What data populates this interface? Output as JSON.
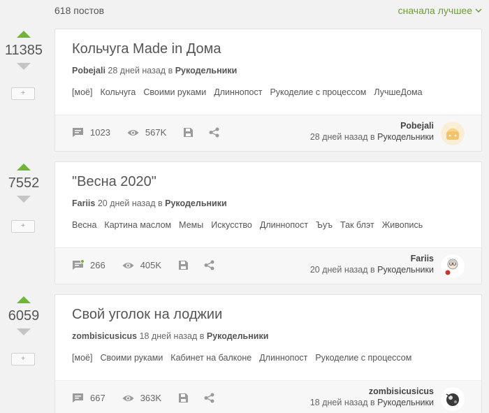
{
  "header": {
    "posts_count": "618 постов",
    "sort_label": "сначала лучшее"
  },
  "stories": [
    {
      "rating": "11385",
      "title": "Кольчуга Made in Дома",
      "author": "Pobejali",
      "date": "28 дней назад",
      "in": "в",
      "community": "Рукодельники",
      "tags": [
        "[моё]",
        "Кольчуга",
        "Своими руками",
        "Длиннопост",
        "Рукоделие с процессом",
        "ЛучшеДома"
      ],
      "comments": "1023",
      "views": "567K",
      "author_sub": "28 дней назад в"
    },
    {
      "rating": "7552",
      "title": "\"Весна 2020\"",
      "author": "Fariis",
      "date": "20 дней назад",
      "in": "в",
      "community": "Рукодельники",
      "tags": [
        "Весна",
        "Картина маслом",
        "Мемы",
        "Искусство",
        "Длиннопост",
        "Ъуъ",
        "Так блэт",
        "Живопись"
      ],
      "comments": "266",
      "views": "405K",
      "author_sub": "20 дней назад в"
    },
    {
      "rating": "6059",
      "title": "Свой уголок на лоджии",
      "author": "zombisicusicus",
      "date": "18 дней назад",
      "in": "в",
      "community": "Рукодельники",
      "tags": [
        "[моё]",
        "Своими руками",
        "Кабинет на балконе",
        "Длиннопост",
        "Рукоделие с процессом"
      ],
      "comments": "667",
      "views": "363K",
      "author_sub": "18 дней назад в"
    }
  ],
  "colors": {
    "accent": "#71b43a",
    "sort_link": "#6a9f32",
    "comment_dot": "#71b43a"
  }
}
